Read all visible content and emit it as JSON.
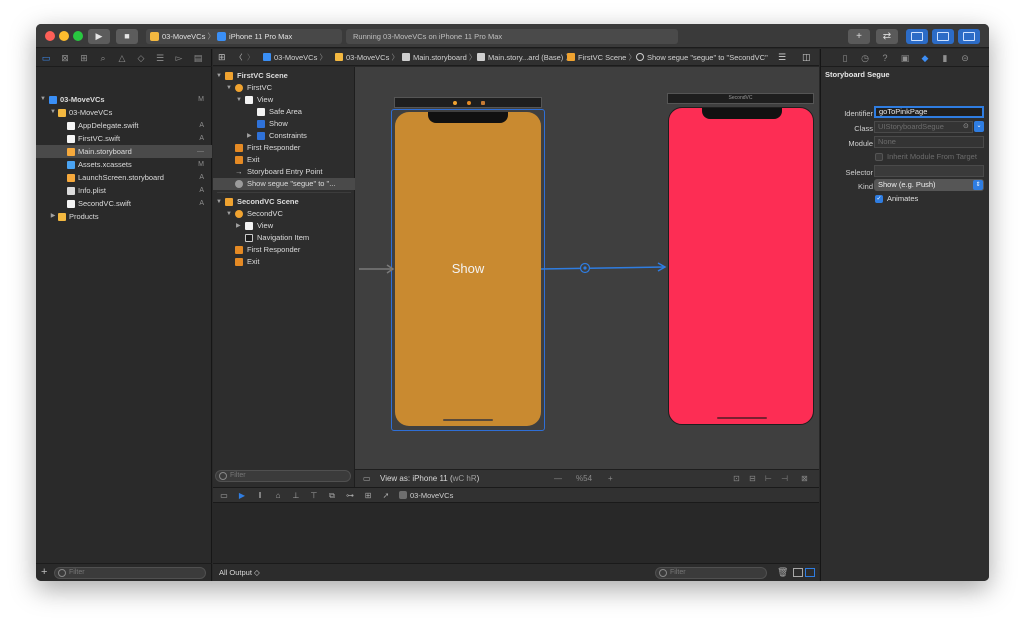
{
  "toolbar": {
    "scheme_target": "03-MoveVCs",
    "scheme_device": "iPhone 11 Pro Max",
    "activity_status": "Running 03-MoveVCs on iPhone 11 Pro Max",
    "add_label": "+",
    "swap_label": "⇄",
    "run_icon": "play-icon",
    "stop_icon": "stop-icon"
  },
  "navigator": {
    "tabs": [
      "folder-icon",
      "source-control-icon",
      "symbol-icon",
      "find-icon",
      "issue-icon",
      "test-icon",
      "debug-icon",
      "breakpoint-icon",
      "report-icon"
    ],
    "items": [
      {
        "label": "03-MoveVCs",
        "badge": "M",
        "kind": "project"
      },
      {
        "label": "03-MoveVCs",
        "badge": "",
        "kind": "folder"
      },
      {
        "label": "AppDelegate.swift",
        "badge": "A",
        "kind": "swift"
      },
      {
        "label": "FirstVC.swift",
        "badge": "A",
        "kind": "swift"
      },
      {
        "label": "Main.storyboard",
        "badge": "—",
        "kind": "storyboard"
      },
      {
        "label": "Assets.xcassets",
        "badge": "M",
        "kind": "assets"
      },
      {
        "label": "LaunchScreen.storyboard",
        "badge": "A",
        "kind": "storyboard"
      },
      {
        "label": "Info.plist",
        "badge": "A",
        "kind": "plist"
      },
      {
        "label": "SecondVC.swift",
        "badge": "A",
        "kind": "swift"
      },
      {
        "label": "Products",
        "badge": "",
        "kind": "folder"
      }
    ],
    "filter_placeholder": "Filter",
    "add_label": "+"
  },
  "jumpbar": {
    "items": [
      "03-MoveVCs",
      "03-MoveVCs",
      "Main.storyboard",
      "Main.story...ard (Base)",
      "FirstVC Scene",
      "Show segue \"segue\" to \"SecondVC\""
    ]
  },
  "outline": {
    "rows": [
      {
        "label": "FirstVC Scene",
        "head": true
      },
      {
        "label": "FirstVC"
      },
      {
        "label": "View"
      },
      {
        "label": "Safe Area"
      },
      {
        "label": "Show"
      },
      {
        "label": "Constraints"
      },
      {
        "label": "First Responder"
      },
      {
        "label": "Exit"
      },
      {
        "label": "Storyboard Entry Point"
      },
      {
        "label": "Show segue \"segue\" to \"..."
      },
      {
        "label": "SecondVC Scene",
        "head": true
      },
      {
        "label": "SecondVC"
      },
      {
        "label": "View"
      },
      {
        "label": "Navigation Item"
      },
      {
        "label": "First Responder"
      },
      {
        "label": "Exit"
      }
    ],
    "filter_placeholder": "Filter"
  },
  "canvas": {
    "first_button_label": "Show",
    "second_title": "SecondVC",
    "first_color": "#c98a30",
    "second_color": "#fd2d54",
    "view_as": "View as: iPhone 11 (",
    "view_as_traits": "wC hR",
    "zoom_minus": "—",
    "zoom_value": "%54",
    "zoom_plus": "+"
  },
  "debug": {
    "target": "03-MoveVCs",
    "output_label": "All Output ◇",
    "filter_placeholder": "Filter"
  },
  "inspector": {
    "tabs": [
      "file-icon",
      "history-icon",
      "help-icon",
      "identity-icon",
      "attributes-icon",
      "size-icon",
      "connections-icon"
    ],
    "section_title": "Storyboard Segue",
    "identifier_label": "Identifier",
    "identifier_value": "goToPinkPage",
    "class_label": "Class",
    "class_placeholder": "UIStoryboardSegue",
    "module_label": "Module",
    "module_placeholder": "None",
    "inherit_label": "Inherit Module From Target",
    "selector_label": "Selector",
    "kind_label": "Kind",
    "kind_value": "Show (e.g. Push)",
    "animates_label": "Animates"
  }
}
